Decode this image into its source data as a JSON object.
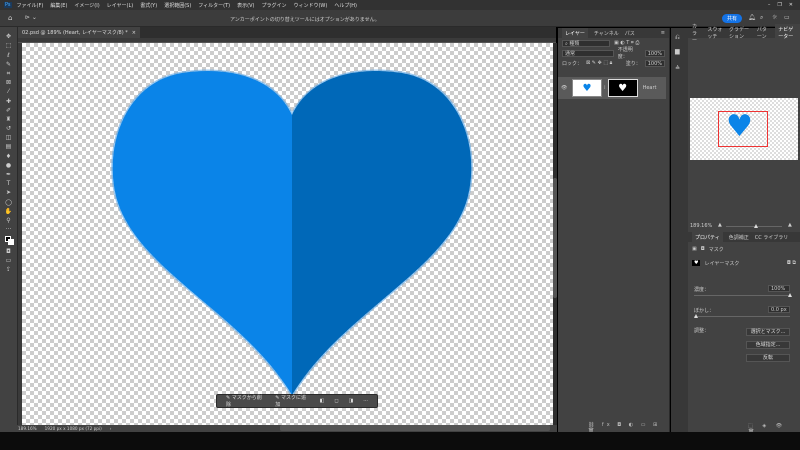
{
  "menu": [
    "ファイル(F)",
    "編集(E)",
    "イメージ(I)",
    "レイヤー(L)",
    "書式(Y)",
    "選択範囲(S)",
    "フィルター(T)",
    "表示(V)",
    "プラグイン",
    "ウィンドウ(W)",
    "ヘルプ(H)"
  ],
  "window_controls": {
    "minimize": "–",
    "restore": "❐",
    "close": "✕"
  },
  "options": {
    "message": "アンカーポイントの切り替えツールにはオプションがありません。",
    "share": "共有"
  },
  "document": {
    "tab": "02.psd @ 189% (Heart, レイヤーマスク/8) *",
    "close": "×",
    "colors": {
      "left": "#0a84e8",
      "right": "#0068b8"
    }
  },
  "status": {
    "zoom": "189.16%",
    "size": "1920 px x 1080 px (72 ppi)",
    "arrow": "›"
  },
  "context_bar": {
    "subtract": "マスクから削除",
    "add": "マスクに追加",
    "more": "···"
  },
  "layers_panel": {
    "tabs": [
      "レイヤー",
      "チャンネル",
      "パス"
    ],
    "filter": "種類",
    "blend": "通常",
    "opacity_label": "不透明度：",
    "opacity": "100%",
    "lock_label": "ロック：",
    "fill_label": "塗り：",
    "fill": "100%",
    "layer_name": "Heart"
  },
  "navigator_panel": {
    "tabs": [
      "カラー",
      "スウォッチ",
      "グラデーション",
      "パターン",
      "ナビゲーター"
    ],
    "zoom": "189.16%"
  },
  "properties_panel": {
    "tabs": [
      "プロパティ",
      "色調補正",
      "CC ライブラリ"
    ],
    "section": "マスク",
    "mask_label": "レイヤーマスク",
    "density_label": "濃度：",
    "density": "100%",
    "density_value": 1.0,
    "feather_label": "ぼかし：",
    "feather": "0.0 px",
    "feather_value": 0.0,
    "adjust_label": "調整：",
    "buttons": [
      "選択とマスク...",
      "色域指定...",
      "反転"
    ]
  }
}
